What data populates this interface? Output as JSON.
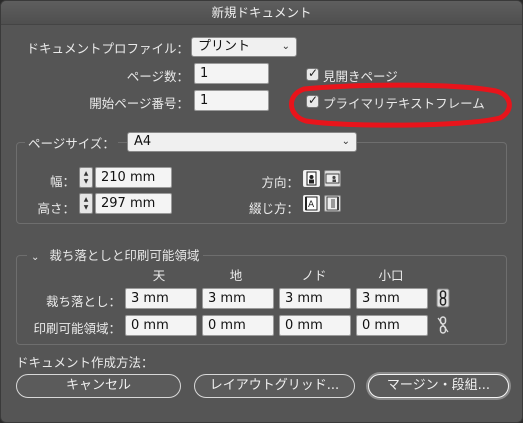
{
  "window": {
    "title": "新規ドキュメント"
  },
  "profile": {
    "label": "ドキュメントプロファイル：",
    "value": "プリント"
  },
  "pages": {
    "label": "ページ数：",
    "value": "1"
  },
  "start_page": {
    "label": "開始ページ番号：",
    "value": "1"
  },
  "facing_pages": {
    "label": "見開きページ",
    "checked": true
  },
  "primary_text_frame": {
    "label": "プライマリテキストフレーム",
    "checked": true
  },
  "page_size": {
    "legend": "ページサイズ：",
    "value": "A4",
    "width_label": "幅：",
    "width_value": "210 mm",
    "height_label": "高さ：",
    "height_value": "297 mm",
    "orientation_label": "方向：",
    "binding_label": "綴じ方："
  },
  "bleed": {
    "legend": "裁ち落としと印刷可能領域",
    "columns": [
      "天",
      "地",
      "ノド",
      "小口"
    ],
    "bleed_label": "裁ち落とし：",
    "bleed_values": [
      "3 mm",
      "3 mm",
      "3 mm",
      "3 mm"
    ],
    "slug_label": "印刷可能領域：",
    "slug_values": [
      "0 mm",
      "0 mm",
      "0 mm",
      "0 mm"
    ]
  },
  "create_method": {
    "label": "ドキュメント作成方法："
  },
  "buttons": {
    "cancel": "キャンセル",
    "layout_grid": "レイアウトグリッド...",
    "margins_columns": "マージン・段組..."
  },
  "colors": {
    "annotation_red": "#e8141b"
  }
}
